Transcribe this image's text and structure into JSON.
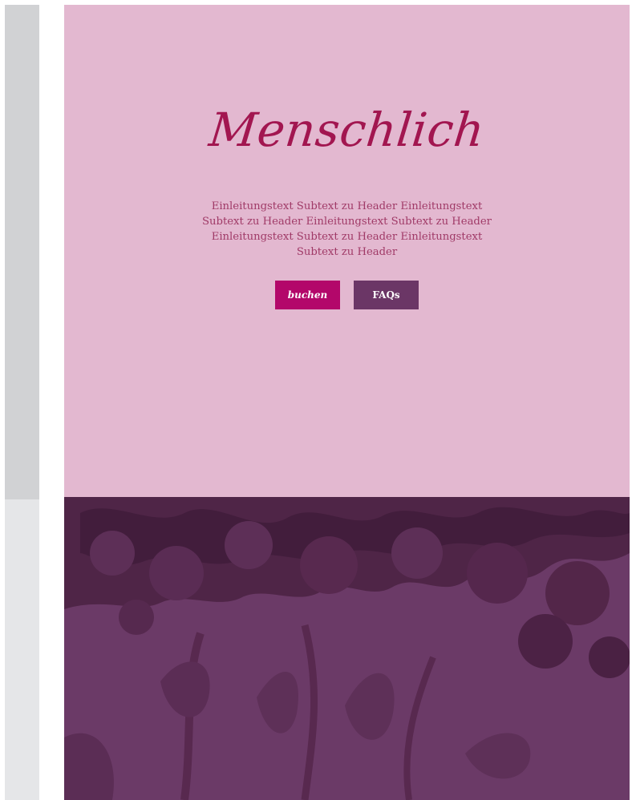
{
  "hero": {
    "title": "Menschlich",
    "subtext": "Einleitungstext Subtext zu Header Einleitungstext Subtext zu Header Einleitungstext Subtext zu Header Einleitungstext Subtext zu Header Einleitungstext Subtext zu Header",
    "book_button": "buchen",
    "faq_button": "FAQs"
  },
  "colors": {
    "hero_background": "#e3b8d0",
    "title_color": "#a21650",
    "subtext_color": "#a03a67",
    "book_button": "#b3076a",
    "faq_button": "#6b3666",
    "image_base": "#6b3a67"
  },
  "icons": {
    "background_image": "lilac-flowers-image"
  }
}
